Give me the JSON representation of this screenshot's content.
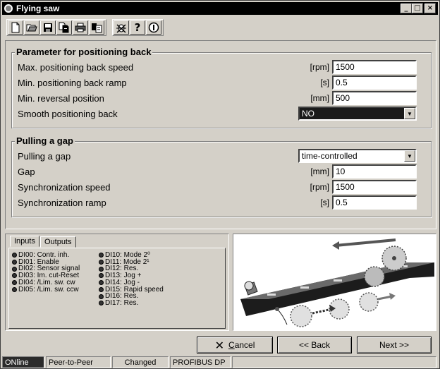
{
  "window": {
    "title": "Flying saw",
    "controls": {
      "minimize": "_",
      "maximize": "□",
      "close": "×"
    }
  },
  "toolbar": {
    "group1": [
      "new-icon",
      "open-icon",
      "save-icon",
      "copy-icon",
      "print-icon",
      "export-icon"
    ],
    "group2": [
      "bug-icon",
      "help-icon",
      "info-icon"
    ]
  },
  "positioning": {
    "title": "Parameter for positioning back",
    "rows": [
      {
        "label": "Max. positioning back speed",
        "unit": "[rpm]",
        "value": "1500"
      },
      {
        "label": "Min. positioning back ramp",
        "unit": "[s]",
        "value": "0.5"
      },
      {
        "label": "Min. reversal position",
        "unit": "[mm]",
        "value": "500"
      }
    ],
    "smooth": {
      "label": "Smooth positioning back",
      "value": "NO"
    }
  },
  "gap": {
    "title": "Pulling a gap",
    "mode": {
      "label": "Pulling a gap",
      "value": "time-controlled"
    },
    "rows": [
      {
        "label": "Gap",
        "unit": "[mm]",
        "value": "10"
      },
      {
        "label": "Synchronization speed",
        "unit": "[rpm]",
        "value": "1500"
      },
      {
        "label": "Synchronization ramp",
        "unit": "[s]",
        "value": "0.5"
      }
    ]
  },
  "io": {
    "tabs": [
      "Inputs",
      "Outputs"
    ],
    "col1": [
      "DI00: Contr. inh.",
      "DI01: Enable",
      "DI02: Sensor signal",
      "DI03: Im. cut-Reset",
      "DI04: /Lim. sw. cw",
      "DI05: /Lim. sw. ccw"
    ],
    "col2": [
      "DI10: Mode 2⁰",
      "DI11: Mode 2¹",
      "DI12: Res.",
      "DI13: Jog +",
      "DI14: Jog -",
      "DI15: Rapid speed",
      "DI16: Res.",
      "DI17: Res."
    ]
  },
  "buttons": {
    "cancel_first": "C",
    "cancel_rest": "ancel",
    "back": "<< Back",
    "next": "Next >>"
  },
  "status": {
    "online": "ONline",
    "peer": "Peer-to-Peer",
    "changed": "Changed",
    "bus": "PROFIBUS DP"
  }
}
